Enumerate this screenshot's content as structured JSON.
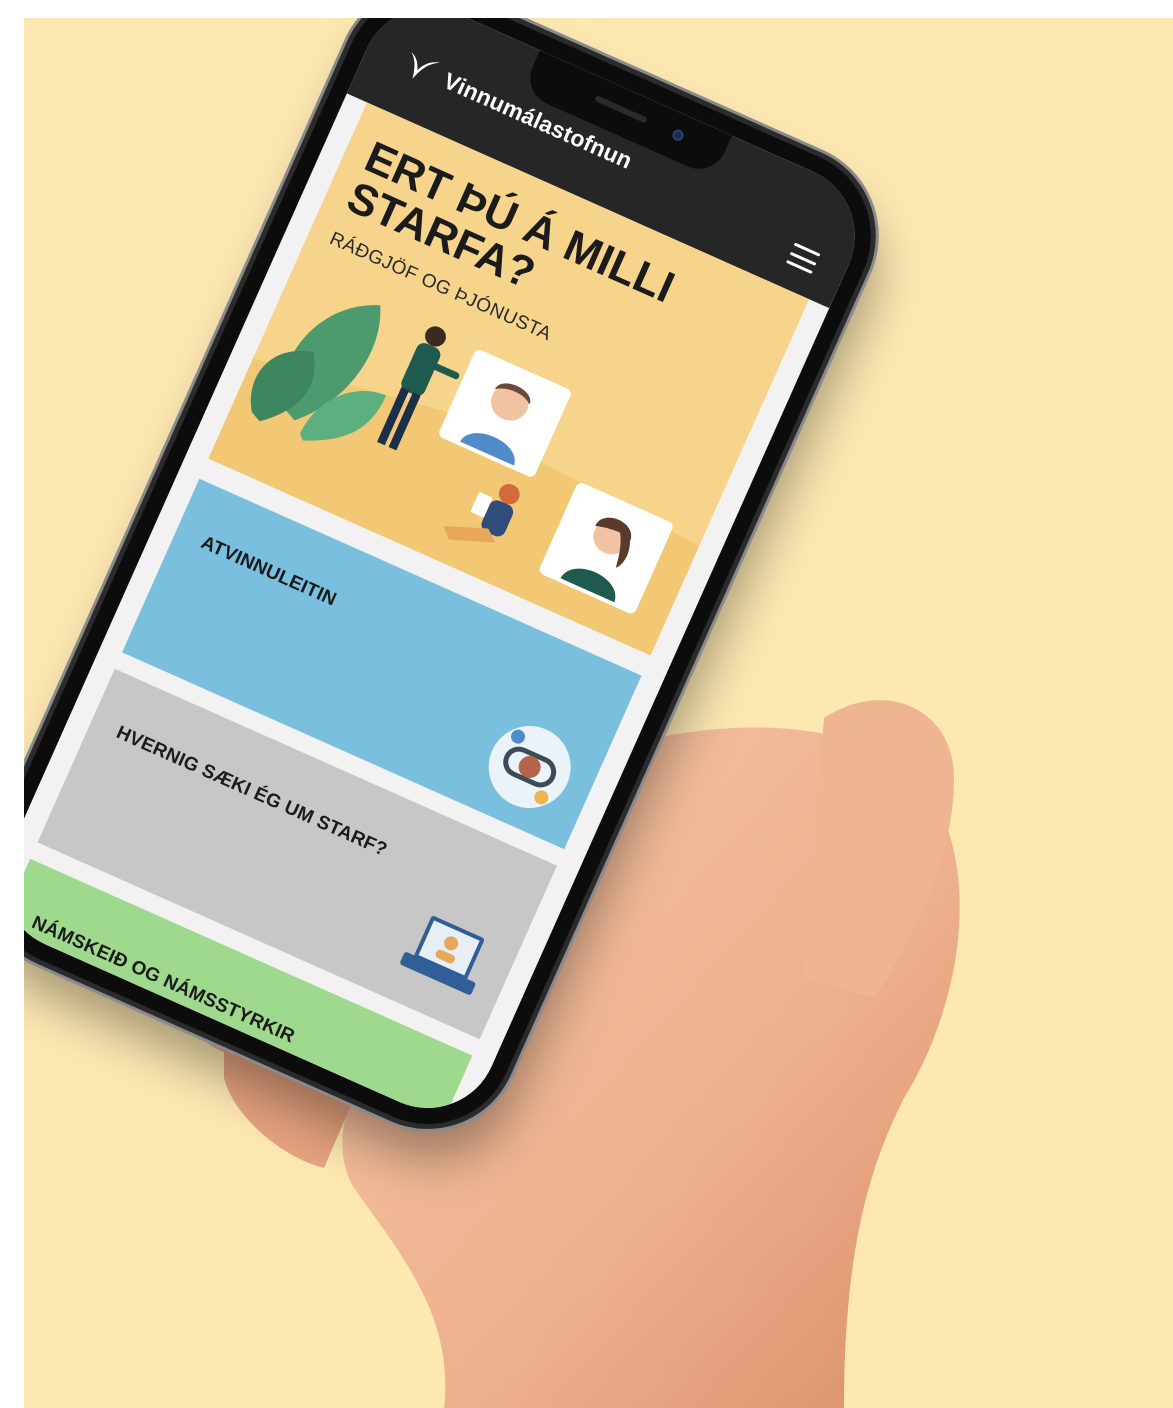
{
  "header": {
    "logo_text": "Vinnumálastofnun",
    "menu_icon": "hamburger-menu-icon"
  },
  "hero": {
    "title": "ERT ÞÚ Á MILLI STARFA?",
    "subtitle": "RÁÐGJÖF OG ÞJÓNUSTA"
  },
  "cards": [
    {
      "label": "ATVINNULEITIN",
      "icon": "job-search-cycle-icon",
      "color": "#7bbfdf"
    },
    {
      "label": "HVERNIG SÆKI ÉG UM STARF?",
      "icon": "laptop-profile-icon",
      "color": "#c7c7c7"
    },
    {
      "label": "NÁMSKEIÐ OG NÁMSSTYRKIR",
      "icon": "graduation-cap-icon",
      "color": "#9ed98e"
    }
  ],
  "colors": {
    "background": "#fde8b2",
    "hero": "#f7d48c",
    "topbar": "#262626"
  }
}
